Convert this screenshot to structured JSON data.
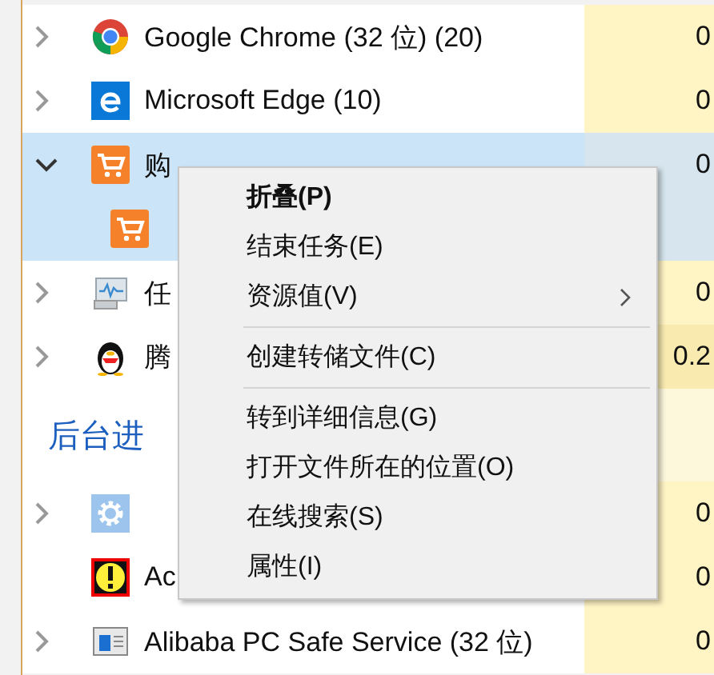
{
  "process_list": [
    {
      "kind": "group",
      "name": "Google Chrome (32 位) (20)",
      "expanded": false,
      "selected": false,
      "cpu": "0"
    },
    {
      "kind": "group",
      "name": "Microsoft Edge (10)",
      "expanded": false,
      "selected": false,
      "cpu": "0"
    },
    {
      "kind": "group",
      "name": "购",
      "expanded": true,
      "selected": true,
      "cpu": "0"
    },
    {
      "kind": "child",
      "selected": true
    },
    {
      "kind": "group",
      "name": "任",
      "expanded": false,
      "selected": false,
      "cpu": "0"
    },
    {
      "kind": "group",
      "name": "腾",
      "expanded": false,
      "selected": false,
      "cpu": "0.2"
    },
    {
      "kind": "heading",
      "name": "后台进"
    },
    {
      "kind": "group",
      "expanded": false,
      "selected": false,
      "cpu": "0"
    },
    {
      "kind": "process",
      "name": "Ac",
      "selected": false,
      "cpu": "0"
    },
    {
      "kind": "group",
      "name": "Alibaba PC Safe Service (32 位)",
      "expanded": false,
      "selected": false,
      "cpu": "0"
    }
  ],
  "context_menu": [
    {
      "kind": "item",
      "label": "折叠(P)",
      "default": true
    },
    {
      "kind": "item",
      "label": "结束任务(E)",
      "default": false
    },
    {
      "kind": "submenu",
      "label": "资源值(V)",
      "default": false
    },
    {
      "kind": "separator"
    },
    {
      "kind": "item",
      "label": "创建转储文件(C)",
      "default": false
    },
    {
      "kind": "separator"
    },
    {
      "kind": "item",
      "label": "转到详细信息(G)",
      "default": false
    },
    {
      "kind": "item",
      "label": "打开文件所在的位置(O)",
      "default": false
    },
    {
      "kind": "item",
      "label": "在线搜索(S)",
      "default": false
    },
    {
      "kind": "item",
      "label": "属性(I)",
      "default": false
    }
  ]
}
